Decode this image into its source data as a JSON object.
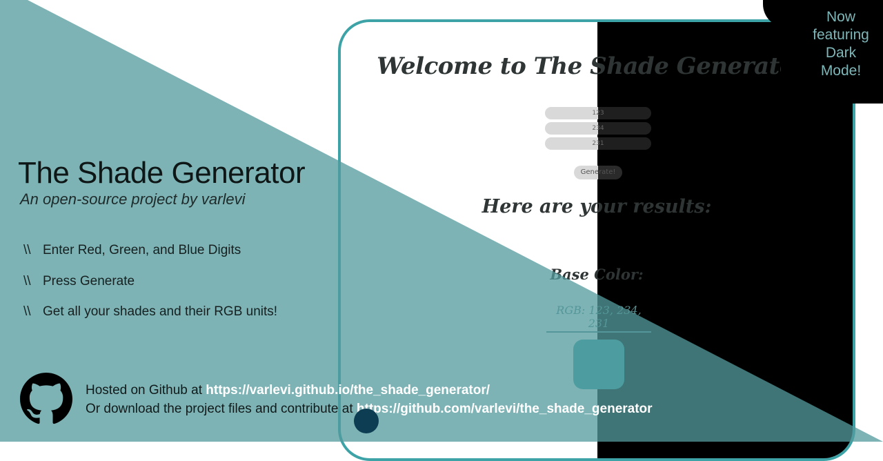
{
  "preview": {
    "welcome": "Welcome to The Shade Generator!",
    "inputs": [
      "123",
      "234",
      "231"
    ],
    "generate_label": "Generate!",
    "results_heading": "Here are your results:",
    "base_color_label": "Base Color:",
    "rgb_text": "RGB: 123, 234, 231",
    "swatch_color": "#3aa8ab"
  },
  "badge": {
    "line1": "Now",
    "line2": "featuring",
    "line3": "Dark",
    "line4": "Mode!"
  },
  "hero": {
    "title": "The Shade Generator",
    "subtitle": "An open-source project by varlevi",
    "steps": [
      {
        "marker": "\\\\",
        "text": "Enter Red, Green, and Blue Digits"
      },
      {
        "marker": "\\\\",
        "text": "Press Generate"
      },
      {
        "marker": "\\\\",
        "text": "Get all your shades and their RGB units!"
      }
    ]
  },
  "footer": {
    "hosted_prefix": "Hosted on Github at ",
    "hosted_url": "https://varlevi.github.io/the_shade_generator/",
    "download_prefix": "Or download the project files and contribute at ",
    "repo_url": "https://github.com/varlevi/the_shade_generator"
  },
  "colors": {
    "accent": "#3da3a6",
    "overlay": "#5ba0a3",
    "dark": "#000000"
  }
}
